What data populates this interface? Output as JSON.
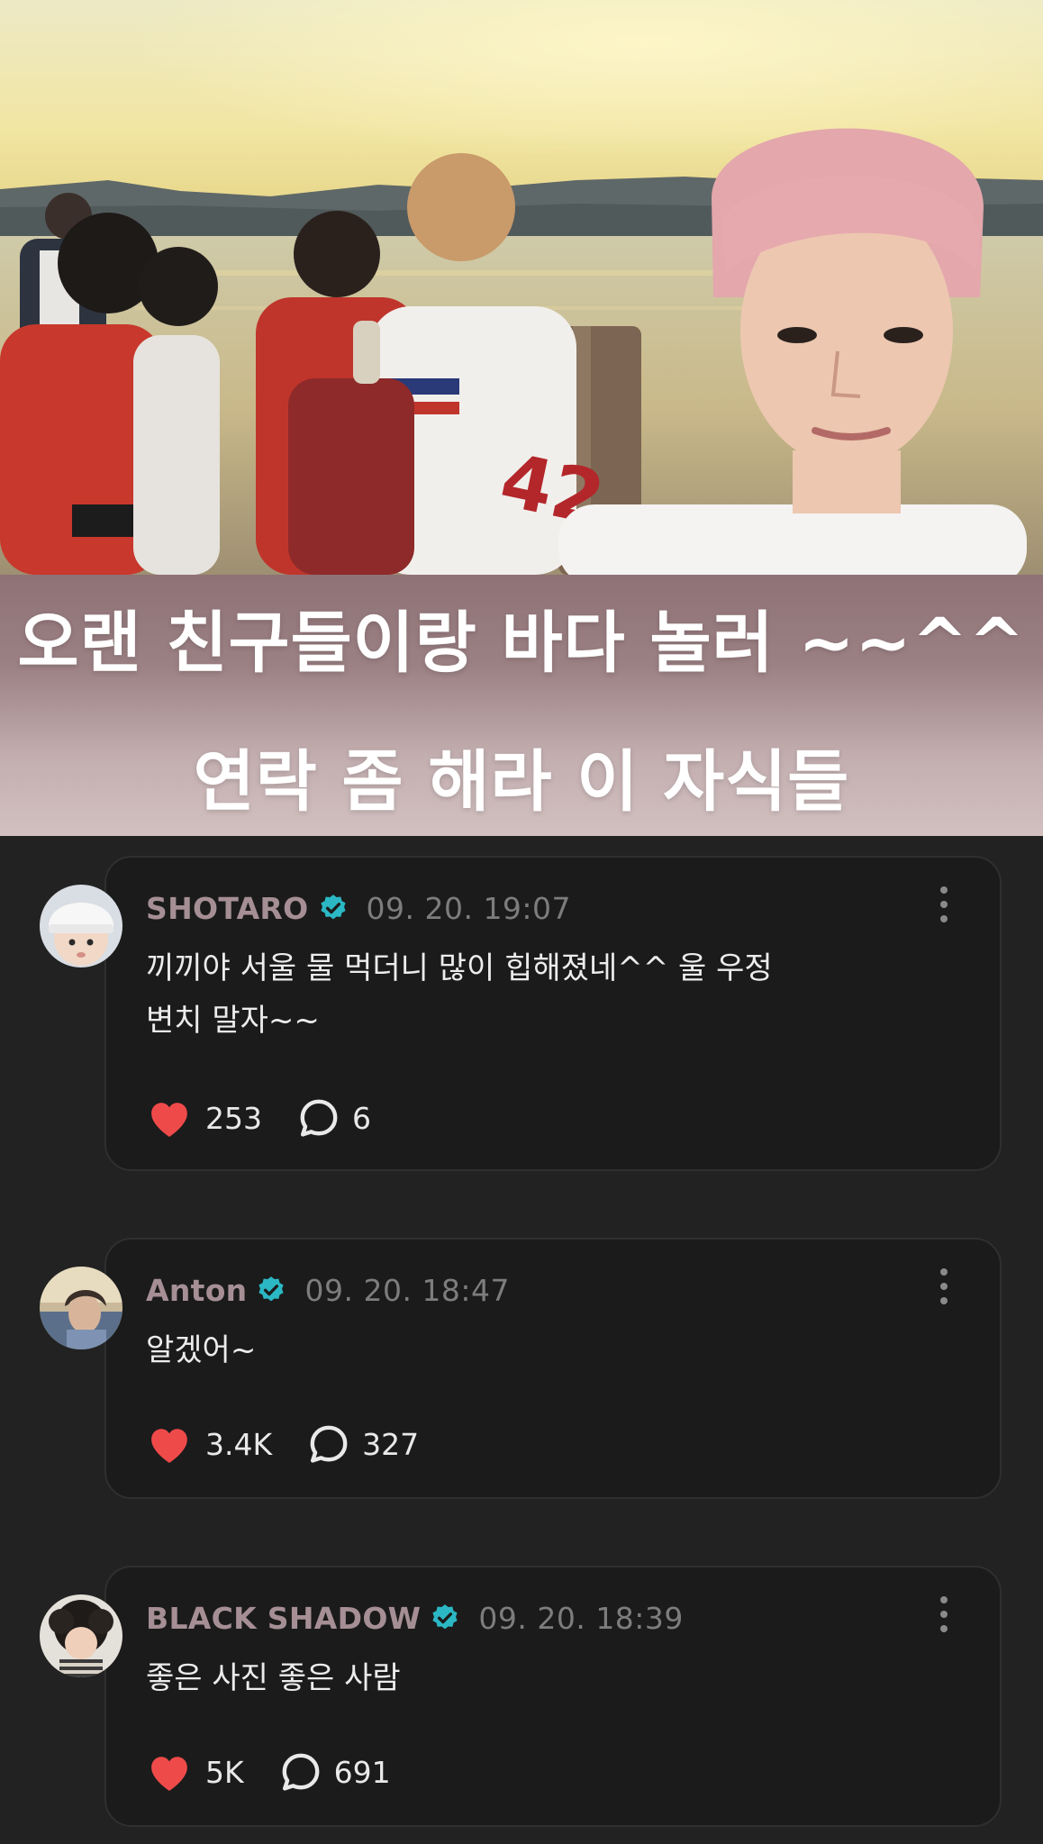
{
  "post": {
    "caption_line1": "오랜 친구들이랑 바다 놀러 ~~^^",
    "caption_line2": "연락 좀 해라 이 자식들"
  },
  "colors": {
    "background": "#222222",
    "card": "#1b1b1b",
    "username": "#a58f95",
    "verified": "#2bb8c4",
    "like": "#ef4a4a"
  },
  "comments": [
    {
      "username": "SHOTARO",
      "timestamp": "09. 20. 19:07",
      "text": "끼끼야 서울 물 먹더니 많이 힙해졌네^^ 울 우정\n변치 말자~~",
      "likes": "253",
      "replies": "6",
      "verified_icon": "verified-badge-icon",
      "menu_icon": "more-vertical-icon"
    },
    {
      "username": "Anton",
      "timestamp": "09. 20. 18:47",
      "text": "알겠어~",
      "likes": "3.4K",
      "replies": "327",
      "verified_icon": "verified-badge-icon",
      "menu_icon": "more-vertical-icon"
    },
    {
      "username": "BLACK SHADOW",
      "timestamp": "09. 20. 18:39",
      "text": "좋은 사진 좋은 사람",
      "likes": "5K",
      "replies": "691",
      "verified_icon": "verified-badge-icon",
      "menu_icon": "more-vertical-icon"
    }
  ]
}
